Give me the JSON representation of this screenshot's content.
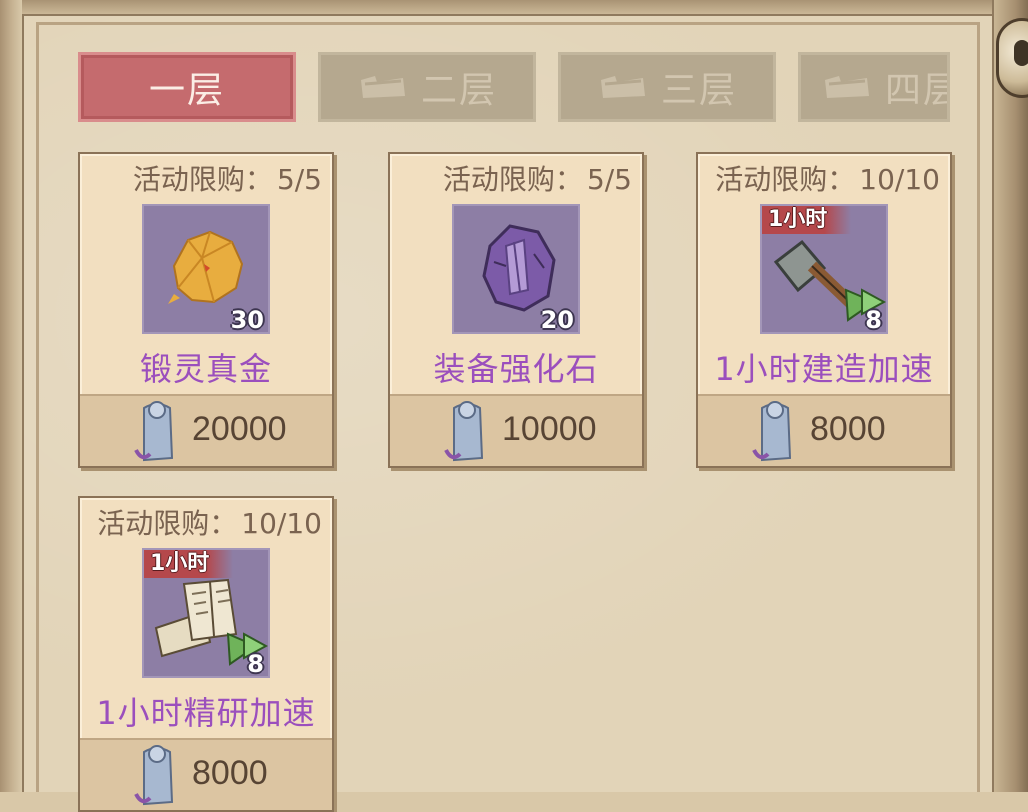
{
  "tabs": [
    {
      "label": "一层",
      "active": true
    },
    {
      "label": "二层",
      "active": false
    },
    {
      "label": "三层",
      "active": false
    },
    {
      "label": "四层",
      "active": false
    }
  ],
  "limit_label": "活动限购：",
  "items": [
    {
      "limit": "5/5",
      "name": "锻灵真金",
      "quantity": "30",
      "price": "20000",
      "tag": "",
      "icon": "gold-ore-icon",
      "color": "#e6a83c"
    },
    {
      "limit": "5/5",
      "name": "装备强化石",
      "quantity": "20",
      "price": "10000",
      "tag": "",
      "icon": "enhance-stone-icon",
      "color": "#7b5aa6"
    },
    {
      "limit": "10/10",
      "name": "1小时建造加速",
      "quantity": "8",
      "price": "8000",
      "tag": "1小时",
      "icon": "build-hammer-icon",
      "color": "#8a8f8c"
    },
    {
      "limit": "10/10",
      "name": "1小时精研加速",
      "quantity": "8",
      "price": "8000",
      "tag": "1小时",
      "icon": "research-scroll-icon",
      "color": "#e8e0c9"
    }
  ],
  "colors": {
    "item_name": "#9b4fbd",
    "tab_active": "#c56b6e",
    "tab_inactive": "#b5a88f",
    "icon_bg": "#8d7ea5",
    "time_tag": "#b5484b"
  },
  "currency_icon": "jade-token-icon"
}
